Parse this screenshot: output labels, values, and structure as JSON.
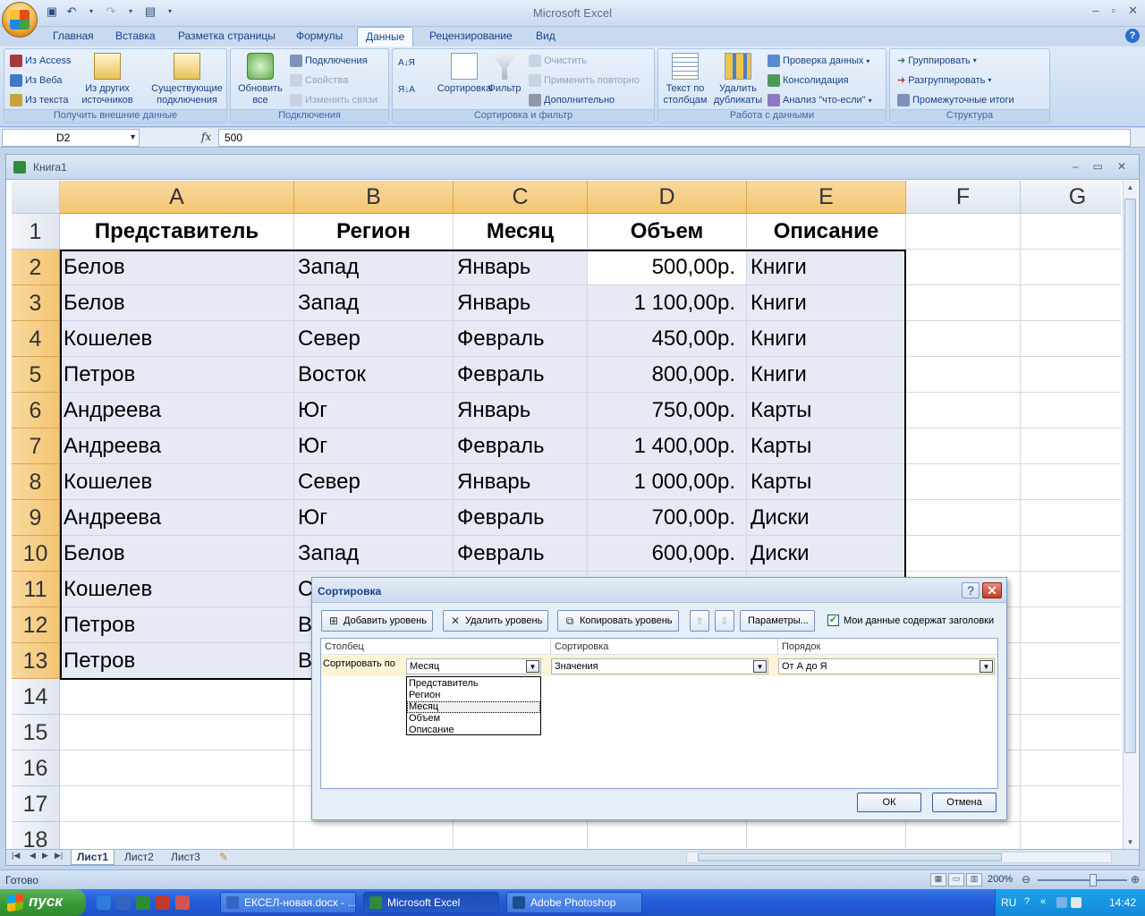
{
  "app": {
    "title": "Microsoft Excel"
  },
  "ribbon": {
    "tabs": [
      "Главная",
      "Вставка",
      "Разметка страницы",
      "Формулы",
      "Данные",
      "Рецензирование",
      "Вид"
    ],
    "active_tab": "Данные",
    "groups": {
      "external": {
        "title": "Получить внешние данные",
        "from_access": "Из Access",
        "from_web": "Из Веба",
        "from_text": "Из текста",
        "from_other_1": "Из других",
        "from_other_2": "источников",
        "existing_1": "Существующие",
        "existing_2": "подключения"
      },
      "connections": {
        "title": "Подключения",
        "refresh_1": "Обновить",
        "refresh_2": "все",
        "connections": "Подключения",
        "properties": "Свойства",
        "edit_links": "Изменить связи"
      },
      "sort_filter": {
        "title": "Сортировка и фильтр",
        "sort": "Сортировка",
        "filter": "Фильтр",
        "clear": "Очистить",
        "reapply": "Применить повторно",
        "advanced": "Дополнительно"
      },
      "data_tools": {
        "title": "Работа с данными",
        "text_to_columns_1": "Текст по",
        "text_to_columns_2": "столбцам",
        "remove_dups_1": "Удалить",
        "remove_dups_2": "дубликаты",
        "validation": "Проверка данных",
        "consolidate": "Консолидация",
        "what_if": "Анализ \"что-если\""
      },
      "outline": {
        "title": "Структура",
        "group": "Группировать",
        "ungroup": "Разгруппировать",
        "subtotal": "Промежуточные итоги"
      }
    }
  },
  "formula_bar": {
    "name_box": "D2",
    "fx": "fx",
    "value": "500"
  },
  "workbook": {
    "title": "Книга1",
    "columns": [
      "A",
      "B",
      "C",
      "D",
      "E",
      "F",
      "G"
    ],
    "rows": [
      "1",
      "2",
      "3",
      "4",
      "5",
      "6",
      "7",
      "8",
      "9",
      "10",
      "11",
      "12",
      "13",
      "14",
      "15",
      "16",
      "17",
      "18"
    ],
    "header": [
      "Представитель",
      "Регион",
      "Месяц",
      "Объем",
      "Описание"
    ],
    "data": [
      [
        "Белов",
        "Запад",
        "Январь",
        "500,00р.",
        "Книги"
      ],
      [
        "Белов",
        "Запад",
        "Январь",
        "1 100,00р.",
        "Книги"
      ],
      [
        "Кошелев",
        "Север",
        "Февраль",
        "450,00р.",
        "Книги"
      ],
      [
        "Петров",
        "Восток",
        "Февраль",
        "800,00р.",
        "Книги"
      ],
      [
        "Андреева",
        "Юг",
        "Январь",
        "750,00р.",
        "Карты"
      ],
      [
        "Андреева",
        "Юг",
        "Февраль",
        "1 400,00р.",
        "Карты"
      ],
      [
        "Кошелев",
        "Север",
        "Январь",
        "1 000,00р.",
        "Карты"
      ],
      [
        "Андреева",
        "Юг",
        "Февраль",
        "700,00р.",
        "Диски"
      ],
      [
        "Белов",
        "Запад",
        "Февраль",
        "600,00р.",
        "Диски"
      ],
      [
        "Кошелев",
        "С",
        "",
        "",
        ""
      ],
      [
        "Петров",
        "В",
        "",
        "",
        ""
      ],
      [
        "Петров",
        "В",
        "",
        "",
        ""
      ]
    ],
    "sheets": [
      "Лист1",
      "Лист2",
      "Лист3"
    ]
  },
  "dialog": {
    "title": "Сортировка",
    "help": "?",
    "add_level": "Добавить уровень",
    "delete_level": "Удалить уровень",
    "copy_level": "Копировать уровень",
    "options": "Параметры...",
    "has_headers_label": "Мои данные содержат заголовки",
    "has_headers_checked": true,
    "col_header": "Столбец",
    "sort_on_header": "Сортировка",
    "order_header": "Порядок",
    "sort_by_label": "Сортировать по",
    "column_value": "Месяц",
    "sort_on_value": "Значения",
    "order_value": "От А до Я",
    "dropdown_options": [
      "Представитель",
      "Регион",
      "Месяц",
      "Объем",
      "Описание"
    ],
    "dropdown_highlighted": "Месяц",
    "ok": "ОК",
    "cancel": "Отмена"
  },
  "status_bar": {
    "status": "Готово",
    "zoom": "200%"
  },
  "taskbar": {
    "start": "пуск",
    "tasks": [
      "ЕКСЕЛ-новая.docx - ...",
      "Microsoft Excel",
      "Adobe Photoshop"
    ],
    "active_task": "Microsoft Excel",
    "lang": "RU",
    "clock": "14:42"
  }
}
